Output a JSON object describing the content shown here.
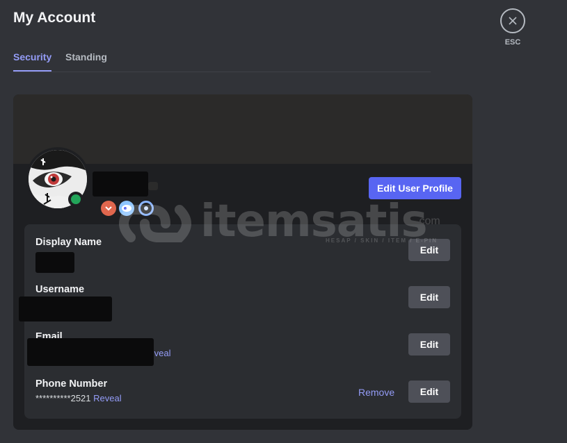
{
  "page": {
    "title": "My Account"
  },
  "tabs": [
    {
      "label": "Security",
      "active": true
    },
    {
      "label": "Standing",
      "active": false
    }
  ],
  "profile": {
    "edit_button": "Edit User Profile",
    "status": "online",
    "badges": [
      "quest-badge-icon",
      "nitro-badge-icon",
      "boost-badge-icon"
    ]
  },
  "fields": {
    "display_name": {
      "label": "Display Name",
      "edit": "Edit"
    },
    "username": {
      "label": "Username",
      "edit": "Edit"
    },
    "email": {
      "label": "Email",
      "reveal": "Reveal",
      "edit": "Edit"
    },
    "phone": {
      "label": "Phone Number",
      "value": "**********2521",
      "reveal": "Reveal",
      "remove": "Remove",
      "edit": "Edit"
    }
  },
  "watermark": {
    "text": "itemsatis",
    "sub": "HESAP / SKIN / ITEM / E-PIN",
    "suffix": ".com"
  },
  "close": {
    "label": "ESC"
  },
  "colors": {
    "accent": "#5865f2",
    "link": "#949cf7",
    "online": "#23a55a",
    "background": "#313338",
    "card": "#1e1f22"
  }
}
